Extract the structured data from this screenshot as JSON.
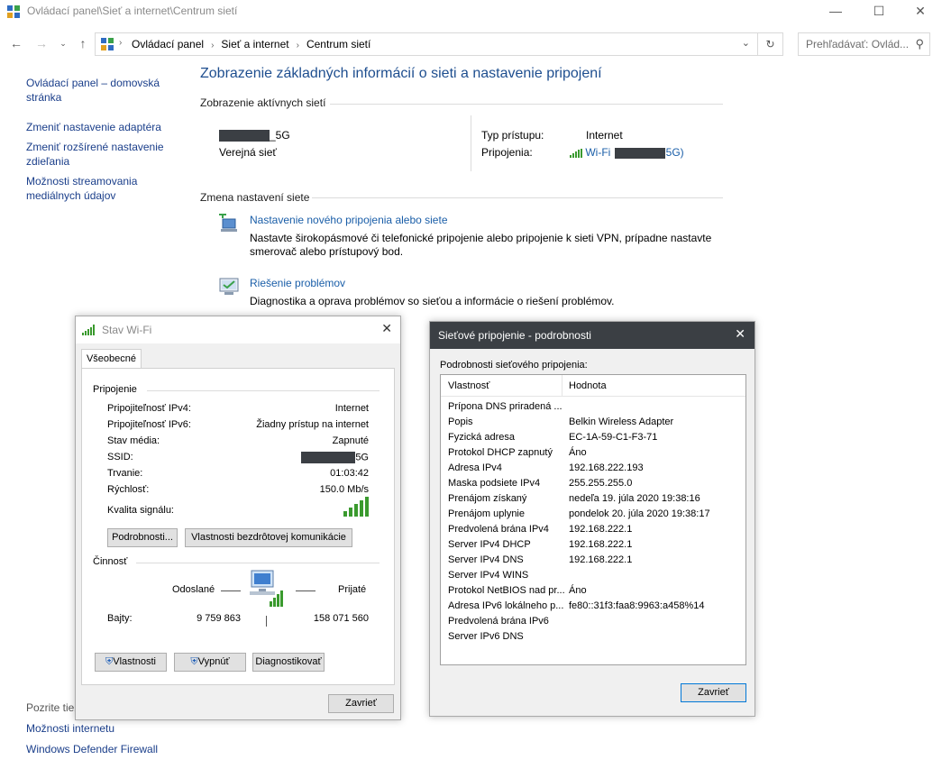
{
  "window": {
    "title": "Ovládací panel\\Sieť a internet\\Centrum sietí",
    "breadcrumbs": [
      "Ovládací panel",
      "Sieť a internet",
      "Centrum sietí"
    ],
    "search_placeholder": "Prehľadávať: Ovlád..."
  },
  "sidebar": {
    "items": [
      "Ovládací panel – domovská stránka",
      "Zmeniť nastavenie adaptéra",
      "Zmeniť rozšírené nastavenie zdieľania",
      "Možnosti streamovania mediálnych údajov"
    ],
    "see_also_label": "Pozrite tiež",
    "bottom_items": [
      "Možnosti internetu",
      "Windows Defender Firewall"
    ]
  },
  "main": {
    "title": "Zobrazenie základných informácií o sieti a nastavenie pripojení",
    "active_networks_header": "Zobrazenie aktívnych sietí",
    "network_name_suffix": "_5G",
    "network_type": "Verejná sieť",
    "access_type_label": "Typ prístupu:",
    "access_type_value": "Internet",
    "connections_label": "Pripojenia:",
    "connection_link_prefix": "Wi-Fi",
    "connection_link_suffix": "5G)",
    "change_settings_header": "Zmena nastavení siete",
    "new_connection_link": "Nastavenie nového pripojenia alebo siete",
    "new_connection_desc": "Nastavte širokopásmové či telefonické pripojenie alebo pripojenie k sieti VPN, prípadne nastavte smerovač alebo prístupový bod.",
    "troubleshoot_link": "Riešenie problémov",
    "troubleshoot_desc": "Diagnostika a oprava problémov so sieťou a informácie o riešení problémov."
  },
  "wifi_status": {
    "title": "Stav Wi-Fi",
    "tab": "Všeobecné",
    "connection_group": "Pripojenie",
    "rows": [
      {
        "label": "Pripojiteľnosť IPv4:",
        "value": "Internet"
      },
      {
        "label": "Pripojiteľnosť IPv6:",
        "value": "Žiadny prístup na internet"
      },
      {
        "label": "Stav média:",
        "value": "Zapnuté"
      },
      {
        "label": "SSID:",
        "value": "5G"
      },
      {
        "label": "Trvanie:",
        "value": "01:03:42"
      },
      {
        "label": "Rýchlosť:",
        "value": "150.0 Mb/s"
      }
    ],
    "signal_label": "Kvalita signálu:",
    "signal_bars": 5,
    "details_button": "Podrobnosti...",
    "wireless_props_button": "Vlastnosti bezdrôtovej komunikácie",
    "activity_group": "Činnosť",
    "sent_label": "Odoslané",
    "received_label": "Prijaté",
    "bytes_label": "Bajty:",
    "bytes_sent": "9 759 863",
    "bytes_received": "158 071 560",
    "properties_button": "Vlastnosti",
    "disable_button": "Vypnúť",
    "diagnose_button": "Diagnostikovať",
    "close_button": "Zavrieť"
  },
  "details": {
    "title": "Sieťové pripojenie - podrobnosti",
    "group_label": "Podrobnosti sieťového pripojenia:",
    "col_property": "Vlastnosť",
    "col_value": "Hodnota",
    "rows": [
      {
        "p": "Prípona DNS priradená ...",
        "v": ""
      },
      {
        "p": "Popis",
        "v": "Belkin Wireless Adapter"
      },
      {
        "p": "Fyzická adresa",
        "v": "EC-1A-59-C1-F3-71"
      },
      {
        "p": "Protokol DHCP zapnutý",
        "v": "Áno"
      },
      {
        "p": "Adresa IPv4",
        "v": "192.168.222.193"
      },
      {
        "p": "Maska podsiete IPv4",
        "v": "255.255.255.0"
      },
      {
        "p": "Prenájom získaný",
        "v": "nedeľa 19. júla 2020 19:38:16"
      },
      {
        "p": "Prenájom uplynie",
        "v": "pondelok 20. júla 2020 19:38:17"
      },
      {
        "p": "Predvolená brána IPv4",
        "v": "192.168.222.1"
      },
      {
        "p": "Server IPv4 DHCP",
        "v": "192.168.222.1"
      },
      {
        "p": "Server IPv4 DNS",
        "v": "192.168.222.1"
      },
      {
        "p": "Server IPv4 WINS",
        "v": ""
      },
      {
        "p": "Protokol NetBIOS nad pr...",
        "v": "Áno"
      },
      {
        "p": "Adresa IPv6 lokálneho p...",
        "v": "fe80::31f3:faa8:9963:a458%14"
      },
      {
        "p": "Predvolená brána IPv6",
        "v": ""
      },
      {
        "p": "Server IPv6 DNS",
        "v": ""
      }
    ],
    "close_button": "Zavrieť"
  }
}
